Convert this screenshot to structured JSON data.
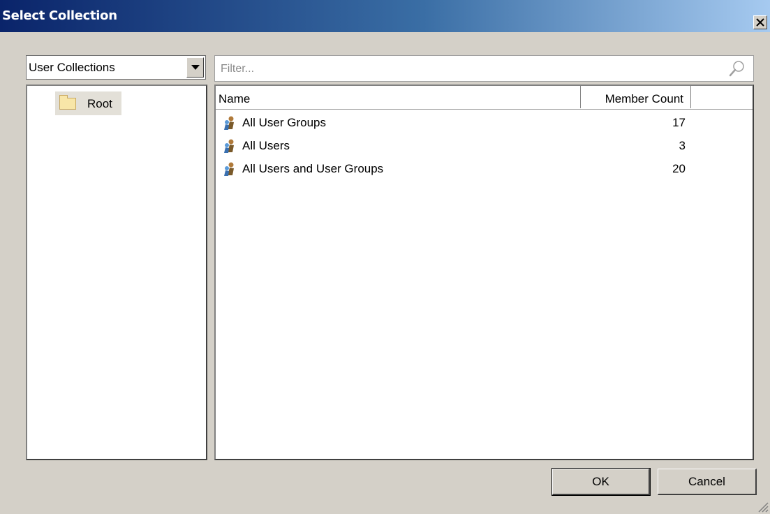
{
  "window": {
    "title": "Select Collection",
    "close_label": "✕"
  },
  "collection_type": {
    "selected": "User Collections"
  },
  "tree": {
    "items": [
      {
        "label": "Root",
        "icon": "folder-icon"
      }
    ]
  },
  "filter": {
    "placeholder": "Filter...",
    "value": ""
  },
  "list": {
    "columns": [
      "Name",
      "Member Count",
      ""
    ],
    "rows": [
      {
        "name": "All User Groups",
        "count": "17",
        "icon": "user-collection-icon"
      },
      {
        "name": "All Users",
        "count": "3",
        "icon": "user-collection-icon"
      },
      {
        "name": "All Users and User Groups",
        "count": "20",
        "icon": "user-collection-icon"
      }
    ]
  },
  "buttons": {
    "ok": "OK",
    "cancel": "Cancel"
  },
  "colors": {
    "titlebar_start": "#0a246a",
    "titlebar_end": "#a6caf0",
    "dialog_background": "#d4d0c8"
  }
}
